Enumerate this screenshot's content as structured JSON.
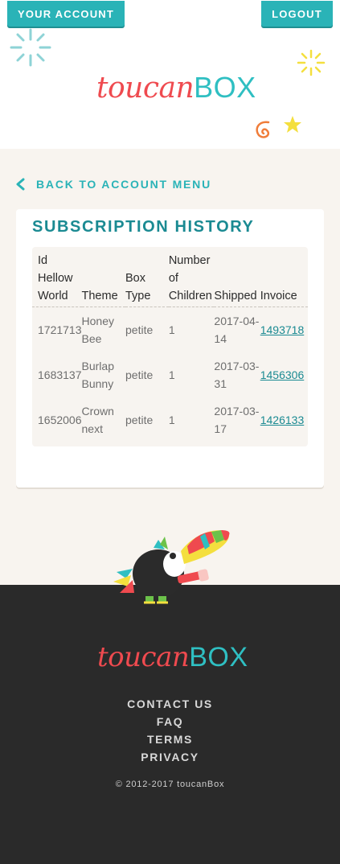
{
  "header": {
    "your_account_label": "YOUR ACCOUNT",
    "logout_label": "LOGOUT",
    "logo_toucan": "toucan",
    "logo_box": "BOX"
  },
  "main": {
    "back_label": "BACK TO ACCOUNT MENU",
    "section_title": "SUBSCRIPTION HISTORY",
    "table": {
      "columns": [
        "Id\nHellow\nWorld",
        "Theme",
        "Box\nType",
        "Number\nof\nChildren",
        "Shipped",
        "Invoice"
      ],
      "rows": [
        {
          "id": "1721713",
          "theme": "Honey Bee",
          "box_type": "petite",
          "children": "1",
          "shipped": "2017-04-14",
          "invoice": "1493718"
        },
        {
          "id": "1683137",
          "theme": "Burlap Bunny",
          "box_type": "petite",
          "children": "1",
          "shipped": "2017-03-31",
          "invoice": "1456306"
        },
        {
          "id": "1652006",
          "theme": "Crown next",
          "box_type": "petite",
          "children": "1",
          "shipped": "2017-03-17",
          "invoice": "1426133"
        }
      ]
    }
  },
  "footer": {
    "logo_toucan": "toucan",
    "logo_box": "BOX",
    "links": [
      "CONTACT US",
      "FAQ",
      "TERMS",
      "PRIVACY"
    ],
    "copyright": "© 2012-2017 toucanBox"
  },
  "colors": {
    "accent": "#2ab3b7",
    "title": "#1a8a92",
    "logo_red": "#ef4a4f",
    "logo_teal": "#2fbfc2",
    "page_bg": "#f8f4ef",
    "footer_bg": "#2a2a2a"
  },
  "icons": {
    "back": "chevron-left-icon",
    "header_left_deco": "sparkle-burst-icon",
    "header_right_deco": "sparkle-burst-icon",
    "header_bottom_deco": "swirl-and-star-icon",
    "footer_mascot": "toucan-mascot-illustration"
  }
}
